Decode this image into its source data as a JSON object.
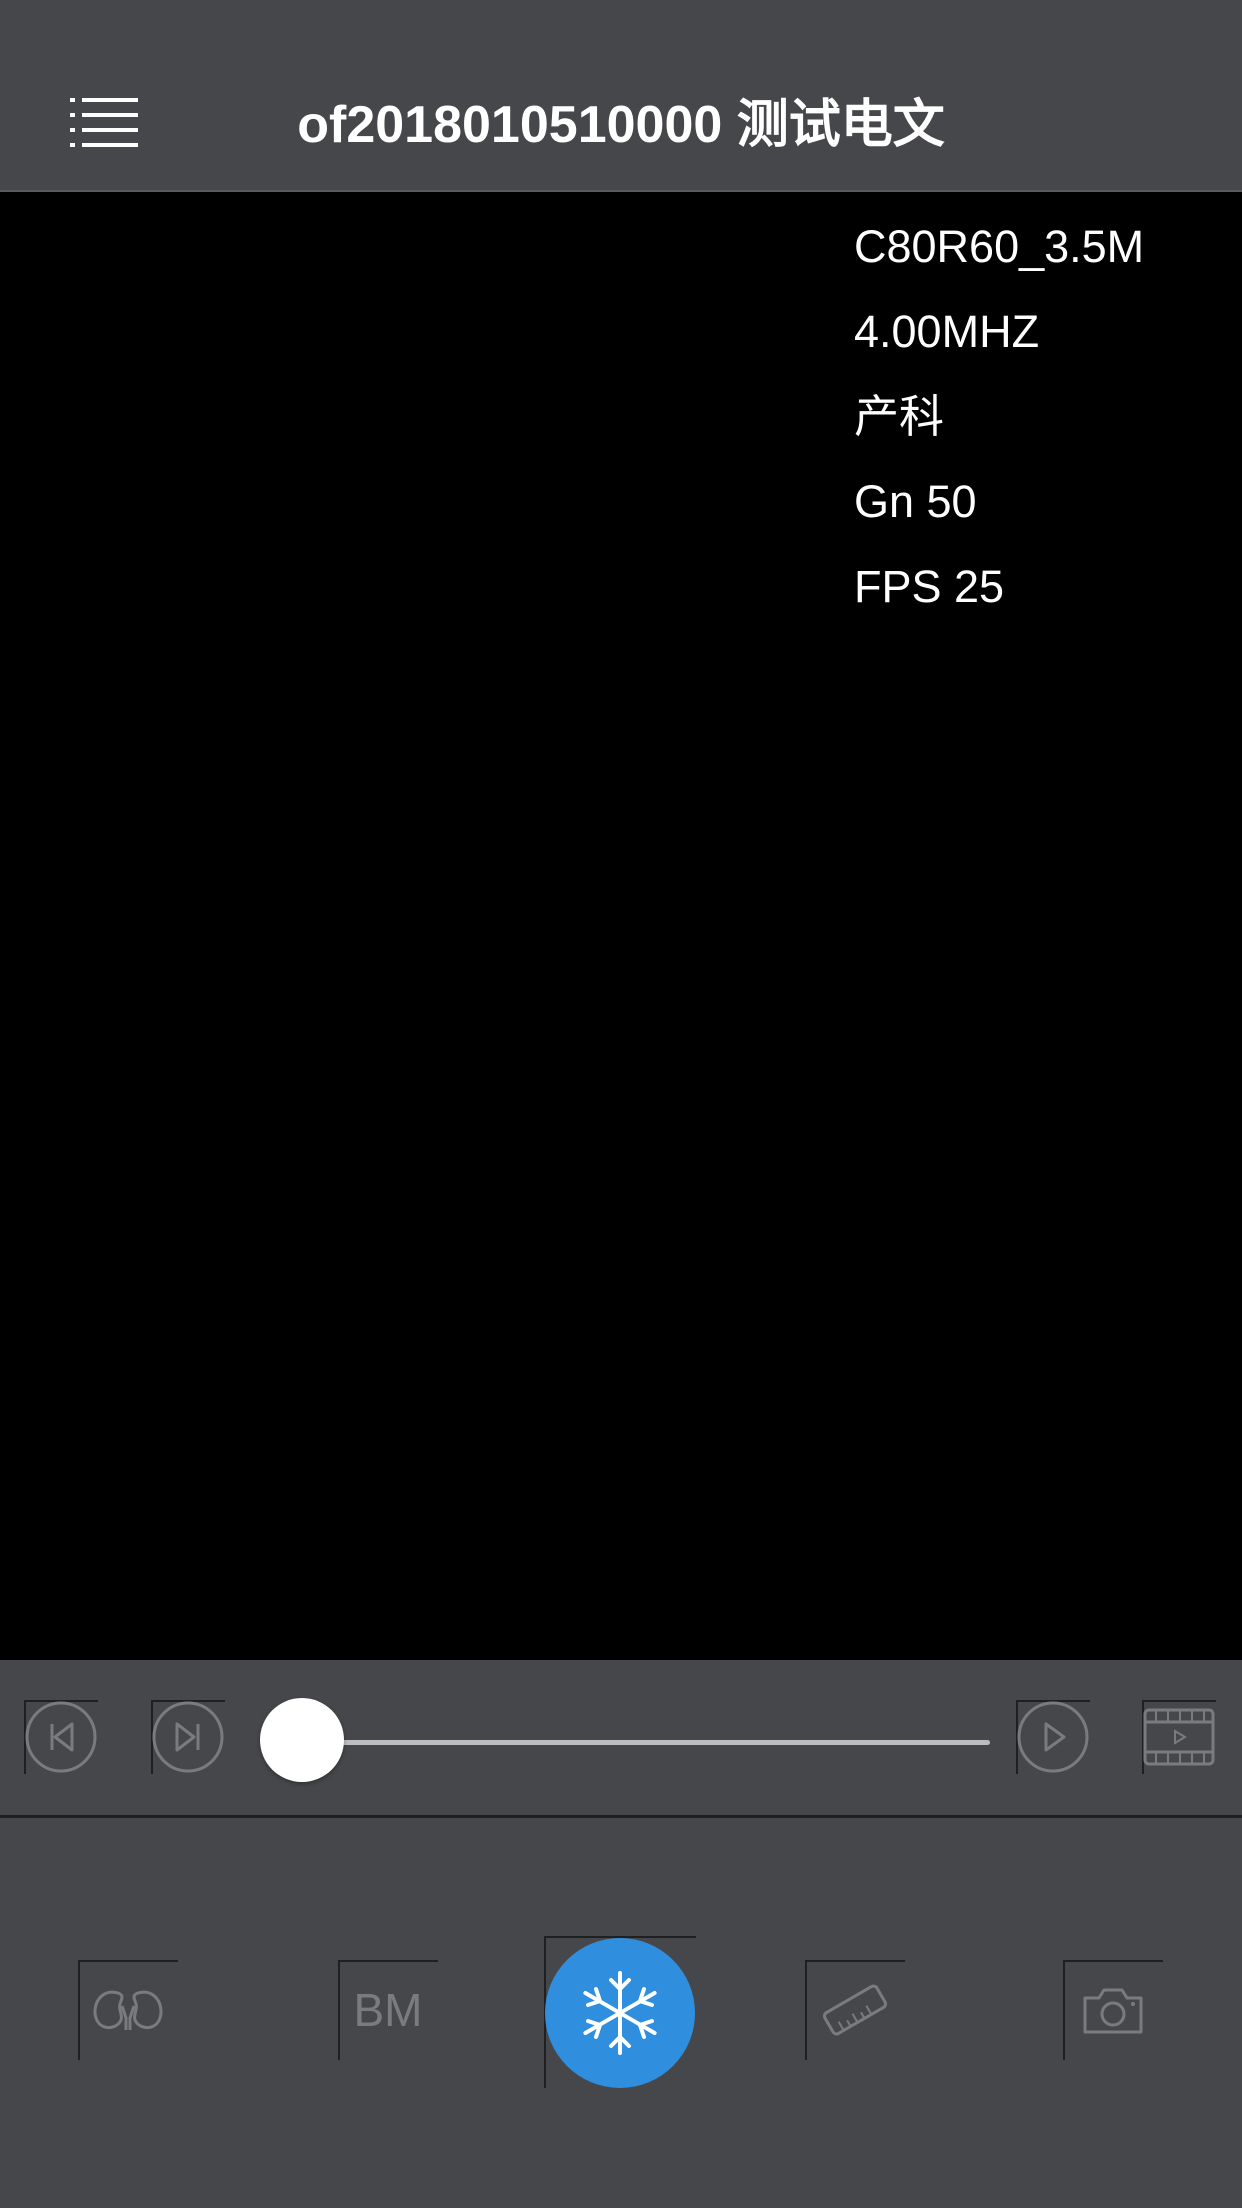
{
  "header": {
    "title": "of2018010510000 测试电文",
    "menu_icon": "list-menu-icon"
  },
  "image_params": {
    "probe": "C80R60_3.5M",
    "frequency": "4.00MHZ",
    "preset": "产科",
    "gain": "Gn 50",
    "fps": "FPS 25"
  },
  "playback": {
    "prev_icon": "skip-previous-icon",
    "next_icon": "skip-next-icon",
    "play_icon": "play-icon",
    "cine_icon": "film-video-icon",
    "progress": 0
  },
  "toolbar": {
    "items": [
      {
        "icon": "kidney-organ-icon"
      },
      {
        "label": "BM"
      },
      {
        "icon": "snowflake-freeze-icon",
        "active": true
      },
      {
        "icon": "ruler-measure-icon"
      },
      {
        "icon": "camera-icon"
      }
    ]
  },
  "colors": {
    "bar_background": "#46474a",
    "image_background": "#000000",
    "accent": "#2f8fde",
    "inactive_icon": "#7a7b7e"
  }
}
